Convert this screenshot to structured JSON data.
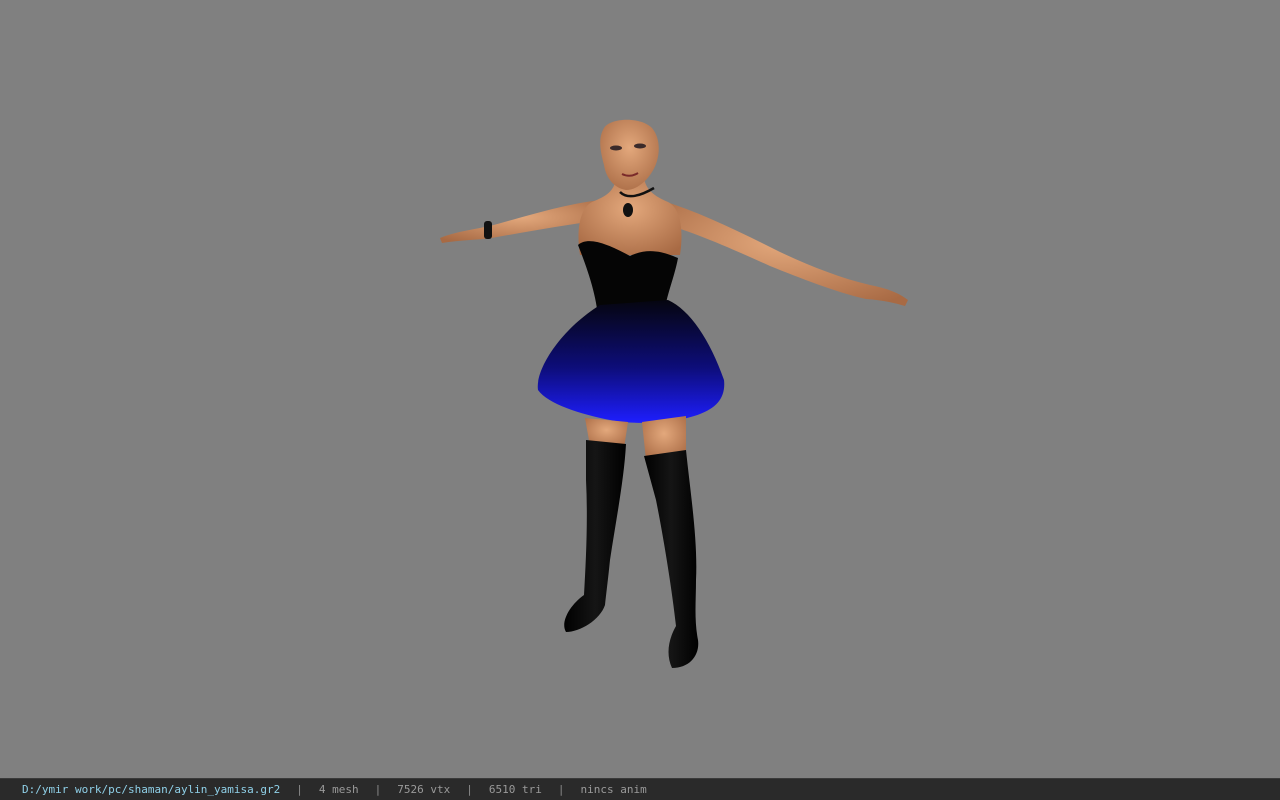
{
  "viewport": {
    "background_color": "#808080",
    "model": {
      "name": "character-model",
      "dress_color": "#1a1aff",
      "skin_color": "#c98a5e"
    }
  },
  "status_bar": {
    "file_path": "D:/ymir work/pc/shaman/aylin_yamisa.gr2",
    "separator": "|",
    "mesh_count": "4 mesh",
    "vertex_count": "7526 vtx",
    "triangle_count": "6510 tri",
    "animation": "nincs anim"
  }
}
